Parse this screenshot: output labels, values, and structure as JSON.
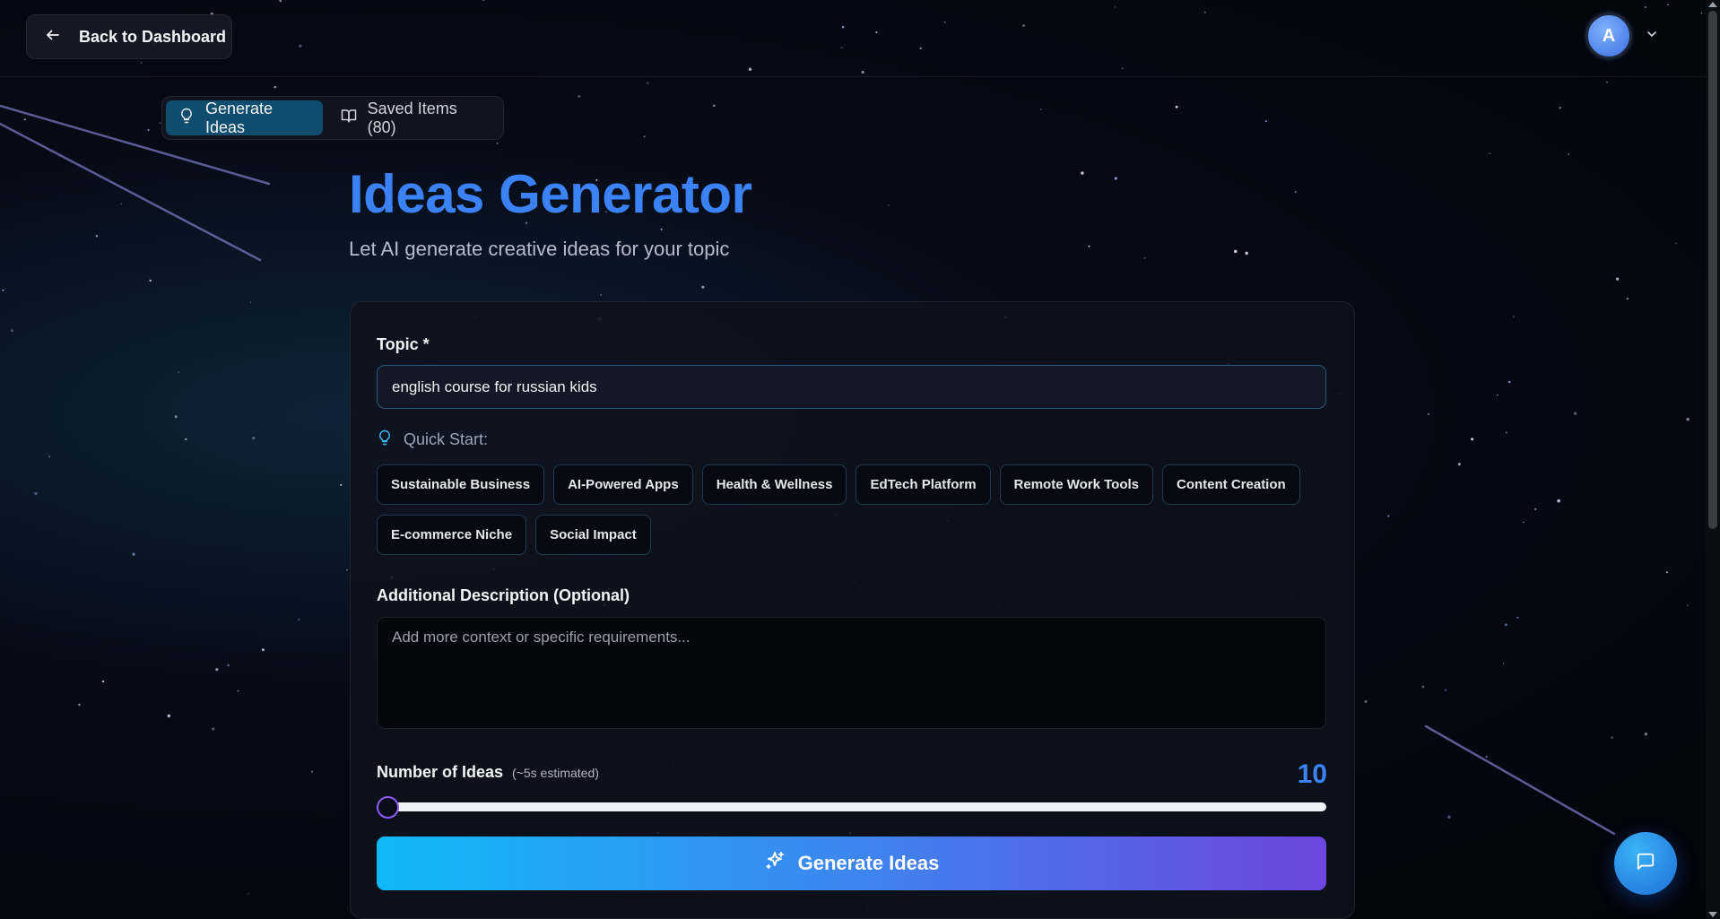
{
  "header": {
    "back_label": "Back to Dashboard",
    "avatar_initial": "A"
  },
  "tabs": [
    {
      "label": "Generate Ideas",
      "icon": "lightbulb-icon",
      "active": true
    },
    {
      "label": "Saved Items (80)",
      "icon": "book-open-icon",
      "active": false
    }
  ],
  "page": {
    "title": "Ideas Generator",
    "subtitle": "Let AI generate creative ideas for your topic"
  },
  "form": {
    "topic_label": "Topic *",
    "topic_value": "english course for russian kids",
    "quick_start_label": "Quick Start:",
    "quick_start_chips": [
      "Sustainable Business",
      "AI-Powered Apps",
      "Health & Wellness",
      "EdTech Platform",
      "Remote Work Tools",
      "Content Creation",
      "E-commerce Niche",
      "Social Impact"
    ],
    "description_label": "Additional Description (Optional)",
    "description_placeholder": "Add more context or specific requirements...",
    "number_label": "Number of Ideas",
    "number_estimate": "(~5s estimated)",
    "number_value": "10",
    "slider_fraction": 0,
    "submit_label": "Generate Ideas"
  },
  "colors": {
    "accent": "#3b82f6",
    "button_gradient": [
      "#10b9f7",
      "#3d86ef",
      "#6d45dd"
    ],
    "active_tab": "#0f4d6e"
  }
}
